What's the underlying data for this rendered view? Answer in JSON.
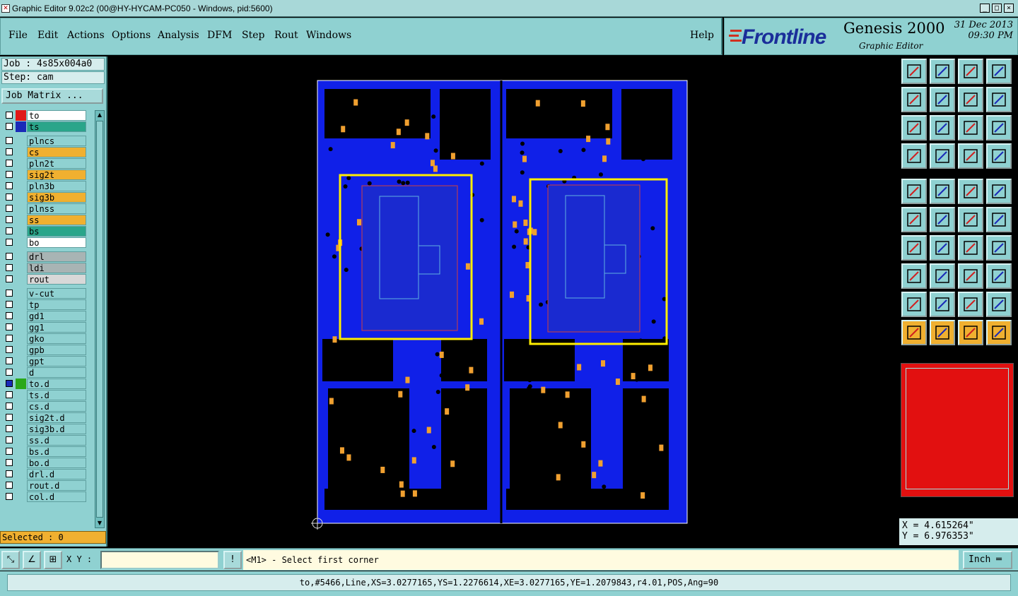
{
  "window": {
    "title": "Graphic Editor 9.02c2 (00@HY-HYCAM-PC050 - Windows, pid:5600)",
    "min": "_",
    "max": "□",
    "close": "×"
  },
  "menu": [
    "File",
    "Edit",
    "Actions",
    "Options",
    "Analysis",
    "DFM",
    "Step",
    "Rout",
    "Windows"
  ],
  "help": "Help",
  "brand": {
    "logo": "Frontline",
    "product": "Genesis 2000",
    "subtitle": "Graphic Editor",
    "date": "31 Dec 2013",
    "time": "09:30 PM"
  },
  "job": {
    "job_line": "Job : 4s85x004a0",
    "step_line": "Step: cam",
    "job_matrix": "Job Matrix ..."
  },
  "layers": [
    {
      "name": "to",
      "bg": "#ffffff",
      "color": "#e01818",
      "checked": false
    },
    {
      "name": "ts",
      "bg": "#2aa58a",
      "color": "#1a2ab8",
      "checked": false
    },
    {
      "name": "plncs",
      "bg": "#8fd1d1",
      "color": "",
      "checked": false
    },
    {
      "name": "cs",
      "bg": "#f0b030",
      "color": "",
      "checked": false
    },
    {
      "name": "pln2t",
      "bg": "#8fd1d1",
      "color": "",
      "checked": false
    },
    {
      "name": "sig2t",
      "bg": "#f0b030",
      "color": "",
      "checked": false
    },
    {
      "name": "pln3b",
      "bg": "#8fd1d1",
      "color": "",
      "checked": false
    },
    {
      "name": "sig3b",
      "bg": "#f0b030",
      "color": "",
      "checked": false
    },
    {
      "name": "plnss",
      "bg": "#8fd1d1",
      "color": "",
      "checked": false
    },
    {
      "name": "ss",
      "bg": "#f0b030",
      "color": "",
      "checked": false
    },
    {
      "name": "bs",
      "bg": "#2aa58a",
      "color": "",
      "checked": false
    },
    {
      "name": "bo",
      "bg": "#ffffff",
      "color": "",
      "checked": false
    },
    {
      "name": "drl",
      "bg": "#a8b4b4",
      "color": "",
      "checked": false
    },
    {
      "name": "ldi",
      "bg": "#a8b4b4",
      "color": "",
      "checked": false
    },
    {
      "name": "rout",
      "bg": "#d8d8d8",
      "color": "",
      "checked": false
    },
    {
      "name": "v-cut",
      "bg": "#8fd1d1",
      "color": "",
      "checked": false
    },
    {
      "name": "tp",
      "bg": "#8fd1d1",
      "color": "",
      "checked": false
    },
    {
      "name": "gd1",
      "bg": "#8fd1d1",
      "color": "",
      "checked": false
    },
    {
      "name": "gg1",
      "bg": "#8fd1d1",
      "color": "",
      "checked": false
    },
    {
      "name": "gko",
      "bg": "#8fd1d1",
      "color": "",
      "checked": false
    },
    {
      "name": "gpb",
      "bg": "#8fd1d1",
      "color": "",
      "checked": false
    },
    {
      "name": "gpt",
      "bg": "#8fd1d1",
      "color": "",
      "checked": false
    },
    {
      "name": "d",
      "bg": "#8fd1d1",
      "color": "",
      "checked": false
    },
    {
      "name": "to.d",
      "bg": "#8fd1d1",
      "color": "#2aa81a",
      "checked": true
    },
    {
      "name": "ts.d",
      "bg": "#8fd1d1",
      "color": "",
      "checked": false
    },
    {
      "name": "cs.d",
      "bg": "#8fd1d1",
      "color": "",
      "checked": false
    },
    {
      "name": "sig2t.d",
      "bg": "#8fd1d1",
      "color": "",
      "checked": false
    },
    {
      "name": "sig3b.d",
      "bg": "#8fd1d1",
      "color": "",
      "checked": false
    },
    {
      "name": "ss.d",
      "bg": "#8fd1d1",
      "color": "",
      "checked": false
    },
    {
      "name": "bs.d",
      "bg": "#8fd1d1",
      "color": "",
      "checked": false
    },
    {
      "name": "bo.d",
      "bg": "#8fd1d1",
      "color": "",
      "checked": false
    },
    {
      "name": "drl.d",
      "bg": "#8fd1d1",
      "color": "",
      "checked": false
    },
    {
      "name": "rout.d",
      "bg": "#8fd1d1",
      "color": "",
      "checked": false
    },
    {
      "name": "col.d",
      "bg": "#8fd1d1",
      "color": "",
      "checked": false
    }
  ],
  "selected": "Selected : 0",
  "coords": {
    "x": "X = 4.615264\"",
    "y": "Y = 6.976353\""
  },
  "cmd": {
    "xy_label": "X Y :",
    "xy_value": "",
    "prompt": "<M1> - Select first corner",
    "units": "Inch"
  },
  "status": "to,#5466,Line,XS=3.0277165,YS=1.2276614,XE=3.0277165,YE=1.2079843,r4.01,POS,Ang=90",
  "toolbar_icons": [
    "open-step-icon",
    "save-icon",
    "home-icon",
    "window-layout-icon",
    "zoom-in-icon",
    "zoom-out-icon",
    "zoom-back-icon",
    "redraw-icon",
    "fit-icon",
    "center-icon",
    "scale-1-2-icon",
    "help-icon",
    "measure-icon",
    "snap-icon",
    "layer-feature-icon",
    "layer-feature-alt-icon",
    "fill-icon",
    "fill-move-icon",
    "ruler-icon",
    "pad-icon",
    "connect-icon",
    "cross-icon",
    "move-red-icon",
    "move-blue-icon",
    "line-red-icon",
    "line-blue-icon",
    "arc-icon",
    "split-icon",
    "copy-icon",
    "line-mid-icon",
    "mirror-icon",
    "group-icon",
    "tri-red-icon",
    "tri-blue-icon",
    "tri-red-alt-icon",
    "tri-blue-alt-icon",
    "select-icon",
    "select-filter-icon",
    "select-rotate-icon",
    "select-net-icon"
  ],
  "colors": {
    "board": "#1020e8",
    "highlight": "#ffee00",
    "copper": "#000000",
    "panel": "#8fd1d1"
  }
}
